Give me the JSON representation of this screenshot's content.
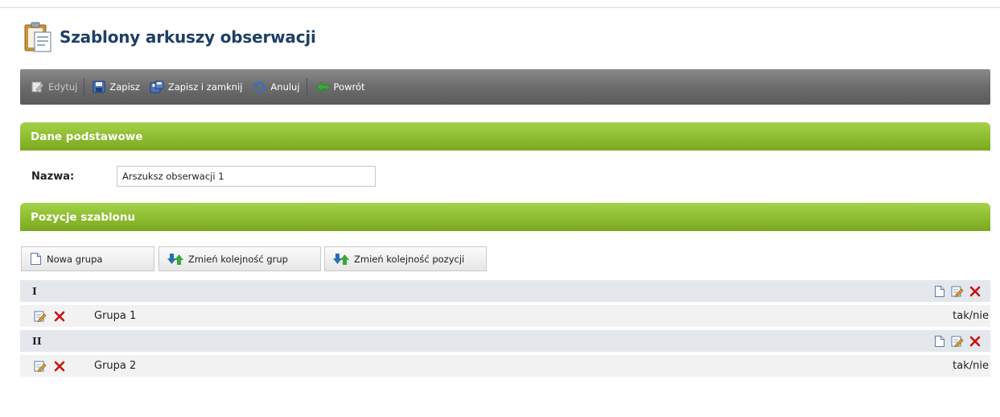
{
  "page": {
    "title": "Szablony arkuszy obserwacji"
  },
  "toolbar": {
    "edit_label": "Edytuj",
    "save_label": "Zapisz",
    "save_close_label": "Zapisz i zamknij",
    "cancel_label": "Anuluj",
    "back_label": "Powrót"
  },
  "sections": {
    "basic": {
      "title": "Dane podstawowe"
    },
    "positions": {
      "title": "Pozycje szablonu"
    }
  },
  "form": {
    "name_label": "Nazwa:",
    "name_value": "Arszuksz obserwacji 1"
  },
  "actions": {
    "new_group": "Nowa grupa",
    "reorder_groups": "Zmień kolejność grup",
    "reorder_positions": "Zmień kolejność pozycji"
  },
  "groups": [
    {
      "label": "I",
      "items": [
        {
          "label": "Grupa 1",
          "type": "tak/nie"
        }
      ]
    },
    {
      "label": "II",
      "items": [
        {
          "label": "Grupa 2",
          "type": "tak/nie"
        }
      ]
    }
  ],
  "colors": {
    "title": "#1f3f66",
    "toolbar": "#6e6e6e",
    "section_header": "#8fbe32",
    "delete": "#cc1111",
    "back_arrow": "#3aa83a"
  },
  "icons": {
    "title": "clipboard-icon",
    "edit": "edit-icon",
    "save": "floppy-icon",
    "save_close": "floppy-close-icon",
    "cancel": "undo-icon",
    "back": "back-arrow-icon",
    "new": "new-document-icon",
    "reorder": "reorder-arrows-icon",
    "delete": "delete-x-icon"
  }
}
